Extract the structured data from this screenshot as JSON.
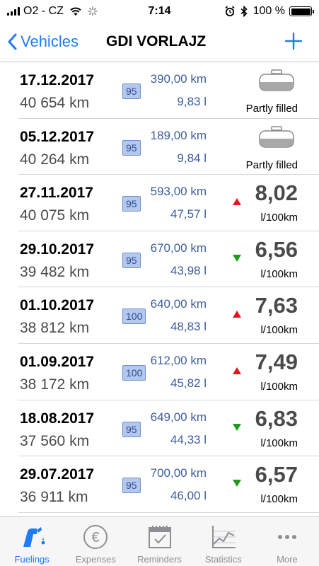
{
  "status_bar": {
    "carrier": "O2 - CZ",
    "time": "7:14",
    "battery": "100 %",
    "battery_level": 1.0
  },
  "nav": {
    "back_label": "Vehicles",
    "title": "GDI VORLAJZ",
    "add_icon": "plus-icon"
  },
  "colors": {
    "accent": "#1f7cf6",
    "trend_up": "#e8141c",
    "trend_down": "#1e9a1e"
  },
  "fuelings": [
    {
      "date": "17.12.2017",
      "odometer": "40 654 km",
      "fuel_type": "95",
      "distance": "390,00 km",
      "volume": "9,83 l",
      "partial": true,
      "partial_label": "Partly filled"
    },
    {
      "date": "05.12.2017",
      "odometer": "40 264 km",
      "fuel_type": "95",
      "distance": "189,00 km",
      "volume": "9,84 l",
      "partial": true,
      "partial_label": "Partly filled"
    },
    {
      "date": "27.11.2017",
      "odometer": "40 075 km",
      "fuel_type": "95",
      "distance": "593,00 km",
      "volume": "47,57 l",
      "partial": false,
      "trend": "up",
      "consumption": "8,02",
      "unit": "l/100km"
    },
    {
      "date": "29.10.2017",
      "odometer": "39 482 km",
      "fuel_type": "95",
      "distance": "670,00 km",
      "volume": "43,98 l",
      "partial": false,
      "trend": "down",
      "consumption": "6,56",
      "unit": "l/100km"
    },
    {
      "date": "01.10.2017",
      "odometer": "38 812 km",
      "fuel_type": "100",
      "distance": "640,00 km",
      "volume": "48,83 l",
      "partial": false,
      "trend": "up",
      "consumption": "7,63",
      "unit": "l/100km"
    },
    {
      "date": "01.09.2017",
      "odometer": "38 172 km",
      "fuel_type": "100",
      "distance": "612,00 km",
      "volume": "45,82 l",
      "partial": false,
      "trend": "up",
      "consumption": "7,49",
      "unit": "l/100km"
    },
    {
      "date": "18.08.2017",
      "odometer": "37 560 km",
      "fuel_type": "95",
      "distance": "649,00 km",
      "volume": "44,33 l",
      "partial": false,
      "trend": "down",
      "consumption": "6,83",
      "unit": "l/100km"
    },
    {
      "date": "29.07.2017",
      "odometer": "36 911 km",
      "fuel_type": "95",
      "distance": "700,00 km",
      "volume": "46,00 l",
      "partial": false,
      "trend": "down",
      "consumption": "6,57",
      "unit": "l/100km"
    }
  ],
  "tabs": [
    {
      "label": "Fuelings",
      "icon": "fuel-pump-icon",
      "active": true
    },
    {
      "label": "Expenses",
      "icon": "euro-icon",
      "active": false
    },
    {
      "label": "Reminders",
      "icon": "calendar-icon",
      "active": false
    },
    {
      "label": "Statistics",
      "icon": "chart-icon",
      "active": false
    },
    {
      "label": "More",
      "icon": "more-icon",
      "active": false
    }
  ]
}
